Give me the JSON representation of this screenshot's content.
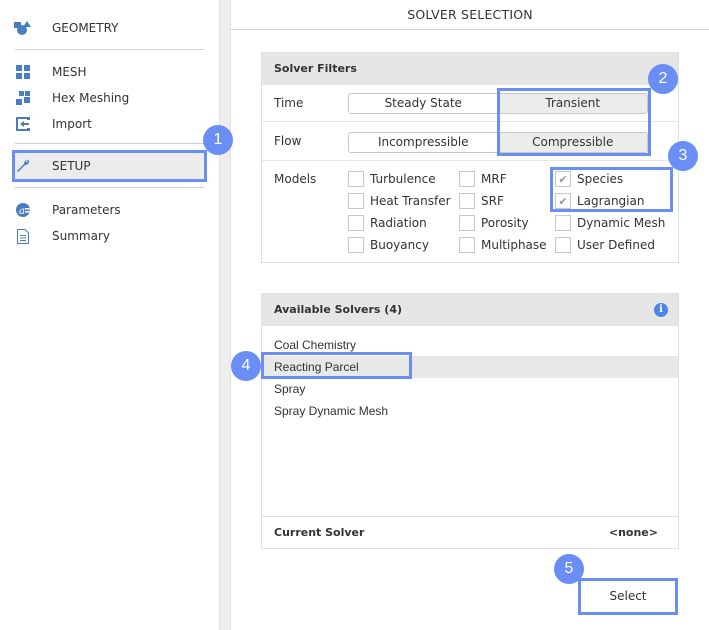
{
  "sidebar": {
    "items": [
      {
        "label": "GEOMETRY",
        "icon": "geometry-shapes-icon"
      },
      {
        "label": "MESH",
        "icon": "mesh-grid-icon"
      },
      {
        "label": "Hex Meshing",
        "icon": "hex-mesh-icon"
      },
      {
        "label": "Import",
        "icon": "import-icon"
      },
      {
        "label": "SETUP",
        "icon": "wrench-icon",
        "active": true
      },
      {
        "label": "Parameters",
        "icon": "parameters-icon"
      },
      {
        "label": "Summary",
        "icon": "document-icon"
      }
    ]
  },
  "main": {
    "title": "SOLVER SELECTION",
    "filters": {
      "header": "Solver Filters",
      "time": {
        "label": "Time",
        "options": [
          "Steady State",
          "Transient"
        ],
        "selected": "Transient"
      },
      "flow": {
        "label": "Flow",
        "options": [
          "Incompressible",
          "Compressible"
        ],
        "selected": "Compressible"
      },
      "models": {
        "label": "Models",
        "items": [
          {
            "label": "Turbulence",
            "checked": false
          },
          {
            "label": "Heat Transfer",
            "checked": false
          },
          {
            "label": "Radiation",
            "checked": false
          },
          {
            "label": "Buoyancy",
            "checked": false
          },
          {
            "label": "MRF",
            "checked": false
          },
          {
            "label": "SRF",
            "checked": false
          },
          {
            "label": "Porosity",
            "checked": false
          },
          {
            "label": "Multiphase",
            "checked": false
          },
          {
            "label": "Species",
            "checked": true
          },
          {
            "label": "Lagrangian",
            "checked": true
          },
          {
            "label": "Dynamic Mesh",
            "checked": false
          },
          {
            "label": "User Defined",
            "checked": false
          }
        ]
      }
    },
    "solvers": {
      "header": "Available Solvers (4)",
      "info_icon": "i",
      "items": [
        "Coal Chemistry",
        "Reacting Parcel",
        "Spray",
        "Spray Dynamic Mesh"
      ],
      "selected": "Reacting Parcel",
      "current_label": "Current Solver",
      "current_value": "<none>"
    },
    "select_button": "Select"
  },
  "annotations": [
    "1",
    "2",
    "3",
    "4",
    "5"
  ],
  "colors": {
    "accent": "#6b8ef5",
    "icon_blue": "#4a7cc0",
    "info_blue": "#4a86e8"
  }
}
